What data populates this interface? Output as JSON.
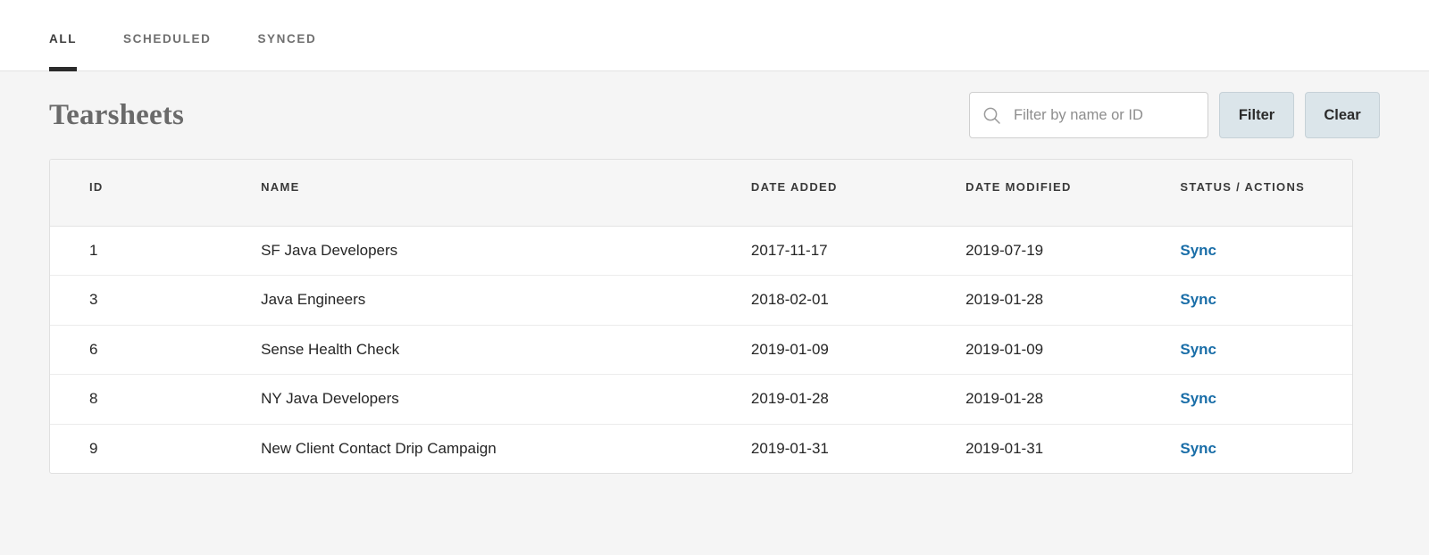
{
  "tabs": [
    {
      "label": "ALL",
      "active": true
    },
    {
      "label": "SCHEDULED",
      "active": false
    },
    {
      "label": "SYNCED",
      "active": false
    }
  ],
  "toolbar": {
    "title": "Tearsheets",
    "search": {
      "placeholder": "Filter by name or ID",
      "value": "",
      "icon": "search-icon"
    },
    "filter_label": "Filter",
    "clear_label": "Clear"
  },
  "table": {
    "columns": [
      "ID",
      "NAME",
      "DATE ADDED",
      "DATE MODIFIED",
      "STATUS / ACTIONS"
    ],
    "rows": [
      {
        "id": "1",
        "name": "SF Java Developers",
        "date_added": "2017-11-17",
        "date_modified": "2019-07-19",
        "action": "Sync"
      },
      {
        "id": "3",
        "name": "Java Engineers",
        "date_added": "2018-02-01",
        "date_modified": "2019-01-28",
        "action": "Sync"
      },
      {
        "id": "6",
        "name": "Sense Health Check",
        "date_added": "2019-01-09",
        "date_modified": "2019-01-09",
        "action": "Sync"
      },
      {
        "id": "8",
        "name": "NY Java Developers",
        "date_added": "2019-01-28",
        "date_modified": "2019-01-28",
        "action": "Sync"
      },
      {
        "id": "9",
        "name": "New Client Contact Drip Campaign",
        "date_added": "2019-01-31",
        "date_modified": "2019-01-31",
        "action": "Sync"
      }
    ]
  },
  "colors": {
    "page_background": "#f5f5f5",
    "accent_link": "#1a6ea8",
    "button_background": "#dbe5ea",
    "active_tab_underline": "#2b2b2b"
  }
}
